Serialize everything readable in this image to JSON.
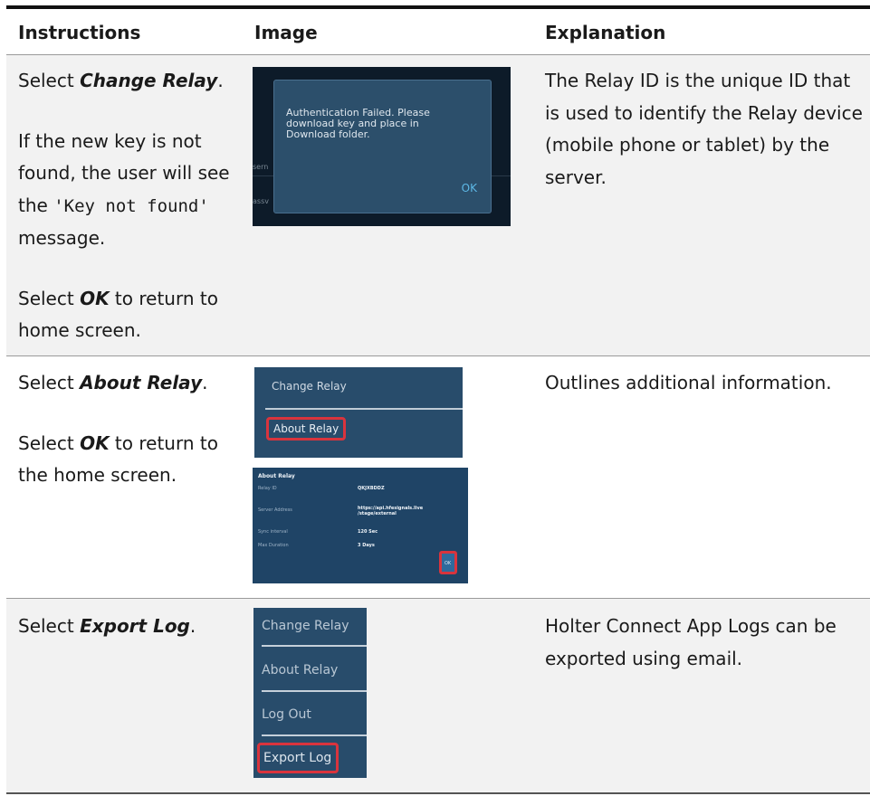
{
  "header": {
    "col1": "Instructions",
    "col2": "Image",
    "col3": "Explanation"
  },
  "rows": [
    {
      "instructions": {
        "select_prefix": "Select ",
        "select_target": "Change Relay",
        "select_suffix": ".",
        "p2_a": "If the new key is not found, the user will see the ",
        "p2_code": "'Key not found'",
        "p2_b": " message.",
        "p3_prefix": "Select ",
        "p3_target": "OK",
        "p3_suffix": " to return to home screen."
      },
      "image": {
        "dialog_text": "Authentication Failed. Please\ndownload key and place in\nDownload folder.",
        "dialog_ok": "OK",
        "partial_label_1": "sern",
        "partial_label_2": "assv"
      },
      "explanation": "The Relay ID is the unique ID that is used to identify the Relay device (mobile phone or tablet) by the server."
    },
    {
      "instructions": {
        "select_prefix": "Select ",
        "select_target": "About Relay",
        "select_suffix": ".",
        "p2_prefix": "Select ",
        "p2_target": "OK",
        "p2_suffix": " to return to the home screen."
      },
      "image": {
        "menu_item_1": "Change Relay",
        "menu_item_2": "About Relay",
        "about_title": "About Relay",
        "rows": [
          {
            "label": "Relay ID",
            "value": "QKJXBDDZ"
          },
          {
            "label": "Server Address",
            "value": "https://api.hfesignals.live\n/stage/external"
          },
          {
            "label": "Sync interval",
            "value": "120 Sec"
          },
          {
            "label": "Max Duration",
            "value": "3 Days"
          }
        ],
        "ok": "OK"
      },
      "explanation": "Outlines additional information."
    },
    {
      "instructions": {
        "select_prefix": "Select ",
        "select_target": "Export Log",
        "select_suffix": "."
      },
      "image": {
        "menu_items": [
          "Change Relay",
          "About Relay",
          "Log Out",
          "Export Log"
        ]
      },
      "explanation": "Holter Connect App Logs can be exported using email."
    }
  ],
  "colors": {
    "row_shade": "#f2f2f2",
    "app_blue": "#284c6b",
    "highlight_red": "#d9343d",
    "ok_blue": "#5db8e6"
  }
}
